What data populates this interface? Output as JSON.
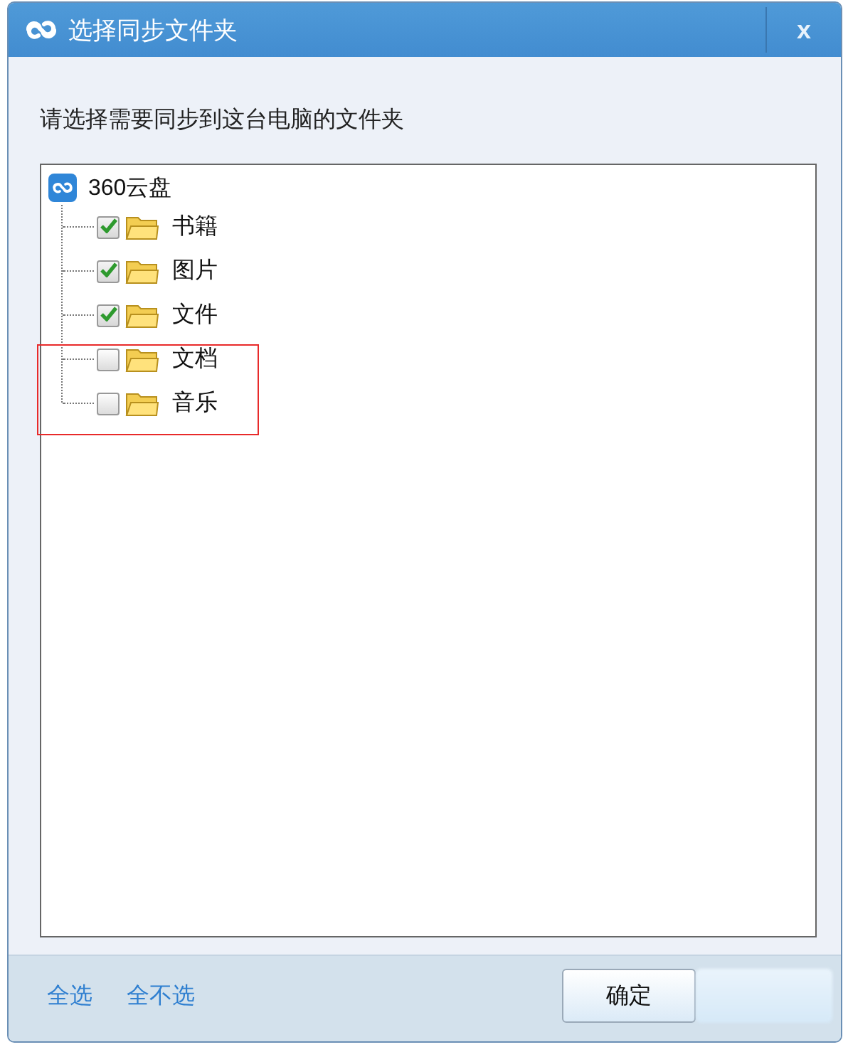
{
  "window": {
    "title": "选择同步文件夹",
    "close": "x"
  },
  "instruction": "请选择需要同步到这台电脑的文件夹",
  "tree": {
    "label": "360云盘",
    "children": [
      {
        "label": "书籍",
        "checked": true
      },
      {
        "label": "图片",
        "checked": true
      },
      {
        "label": "文件",
        "checked": true
      },
      {
        "label": "文档",
        "checked": false
      },
      {
        "label": "音乐",
        "checked": false
      }
    ]
  },
  "links": [
    "全选",
    "全不选"
  ],
  "buttons": [
    "确定"
  ]
}
